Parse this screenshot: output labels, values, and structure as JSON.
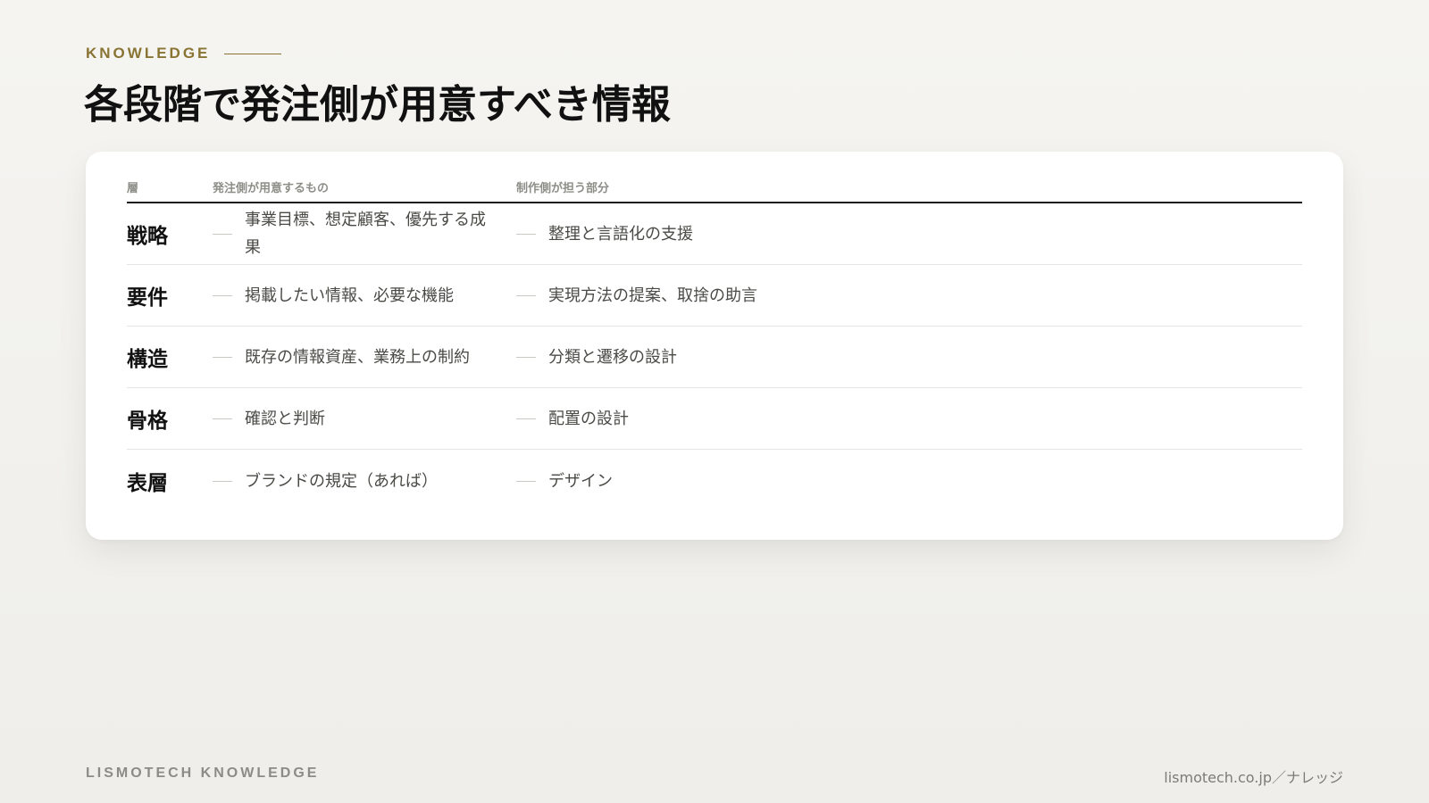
{
  "eyebrow": "KNOWLEDGE",
  "title": "各段階で発注側が用意すべき情報",
  "table": {
    "headers": {
      "layer": "層",
      "client": "発注側が用意するもの",
      "vendor": "制作側が担う部分"
    },
    "rows": [
      {
        "layer": "戦略",
        "client": "事業目標、想定顧客、優先する成果",
        "vendor": "整理と言語化の支援"
      },
      {
        "layer": "要件",
        "client": "掲載したい情報、必要な機能",
        "vendor": "実現方法の提案、取捨の助言"
      },
      {
        "layer": "構造",
        "client": "既存の情報資産、業務上の制約",
        "vendor": "分類と遷移の設計"
      },
      {
        "layer": "骨格",
        "client": "確認と判断",
        "vendor": "配置の設計"
      },
      {
        "layer": "表層",
        "client": "ブランドの規定（あれば）",
        "vendor": "デザイン"
      }
    ]
  },
  "footer": {
    "brand": "LISMOTECH KNOWLEDGE",
    "link": "lismotech.co.jp／ナレッジ"
  },
  "colors": {
    "accent": "#8a7434",
    "background": "#f3f2ef",
    "card": "#ffffff",
    "text": "#111111",
    "muted": "#8e8e88"
  }
}
